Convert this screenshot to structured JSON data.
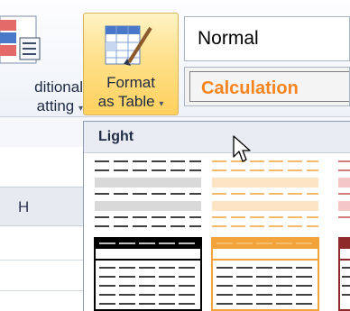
{
  "ribbon": {
    "conditional_formatting": {
      "line1": "ditional",
      "line2": "atting",
      "arrow": "▾"
    },
    "format_as_table": {
      "line1": "Format",
      "line2": "as Table",
      "arrow": "▾"
    },
    "cell_styles": {
      "normal": "Normal",
      "calculation": "Calculation"
    }
  },
  "sheet": {
    "column_header": "H"
  },
  "gallery": {
    "section_label": "Light"
  },
  "colors": {
    "calculation_text": "#f7841e",
    "hover_fill": "#ffd15e"
  },
  "icons": [
    "conditional-formatting-icon",
    "format-as-table-icon",
    "mouse-cursor-icon"
  ]
}
